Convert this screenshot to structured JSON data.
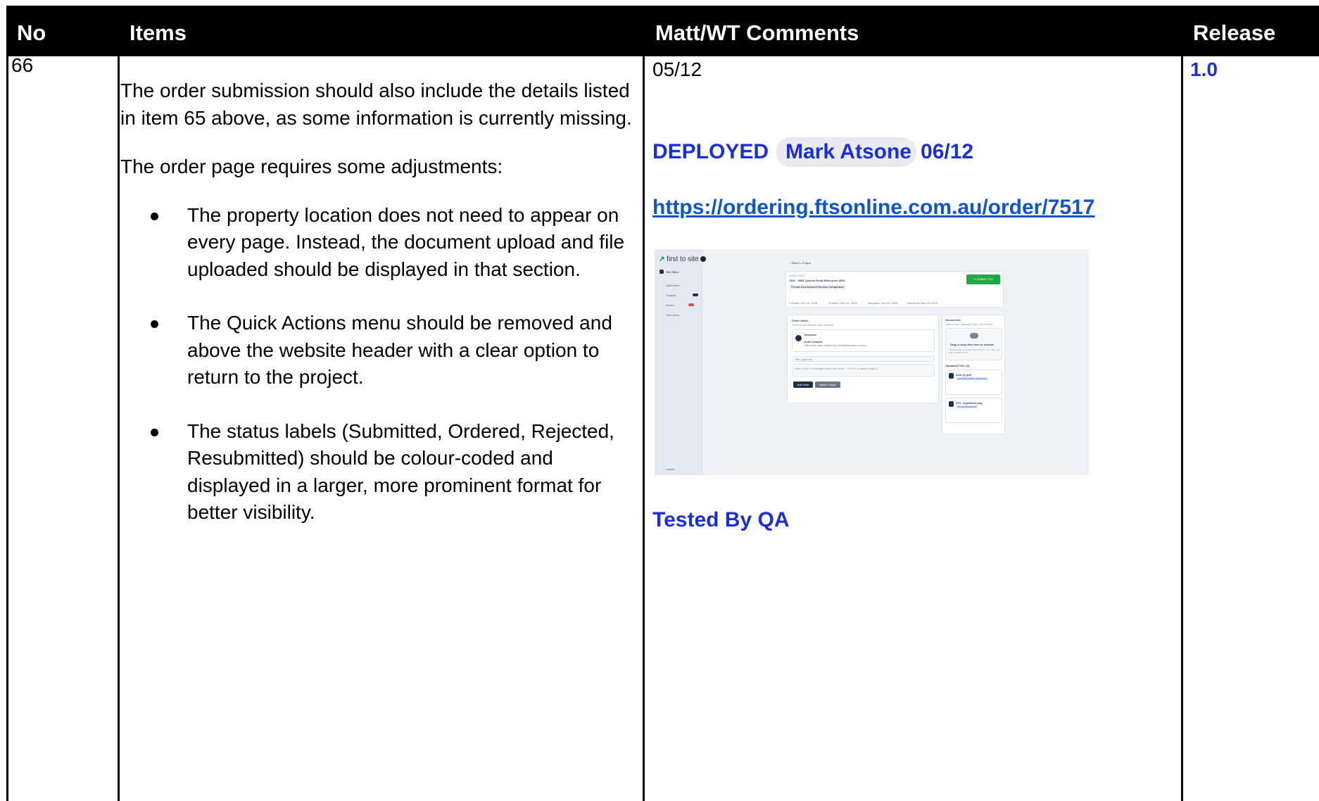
{
  "header": {
    "no": "No",
    "items": "Items",
    "comments": "Matt/WT Comments",
    "release": "Release"
  },
  "row": {
    "no": "66",
    "items": {
      "para1": "The order submission should also include the details listed in item 65 above, as some information is currently missing.",
      "para2": "The order page requires some adjustments:",
      "bullets": [
        "The property location does not need to appear on every page. Instead, the document upload and file uploaded should be displayed in that section.",
        "The Quick Actions menu should be removed and above the website header with a clear option to return to the project.",
        "The status labels (Submitted, Ordered, Rejected, Resubmitted) should be colour-coded and displayed in a larger, more prominent format for better visibility."
      ]
    },
    "comments": {
      "date": "05/12",
      "deployed_label": "DEPLOYED",
      "person_chip": "Mark Atsone",
      "deployed_date": "06/12",
      "link": "https://ordering.ftsonline.com.au/order/7517",
      "tested": "Tested By QA"
    },
    "release": "1.0"
  },
  "screenshot": {
    "logo": "first to site",
    "org": "WA Office",
    "nav": [
      "Dashboard",
      "Projects",
      "Orders",
      "New Order"
    ],
    "logout": "Logout",
    "back": "← Back to Project",
    "order_id": "Order #7517",
    "address": "1522 · 4865 Queens Road Melbourne 3004",
    "pill": "Permit Assessment Review Completion",
    "status": "✔ SUBMITTED",
    "dates": [
      "Created: Dec 04, 2025",
      "Ordered: Dec 04, 2025",
      "Assigned: Dec 04, 2025",
      "Resubmit: Dec 04, 2025"
    ],
    "notes_title": "Order Notes",
    "notes_sub": "Track conversations and updates",
    "note_author": "Unknown",
    "note_body": "Order created",
    "note_detail": "This order was created by name@domain.com.au",
    "new_label": "Title (optional)",
    "new_msg": "Add a note or message about this order... (Ctrl+V to paste images)",
    "add_note": "Add Note",
    "attach": "Attach Image",
    "docs_title": "Documents",
    "docs_sub": "Upload and manage order documents",
    "drop": "Drag & drop files here or browse",
    "supported": "Supported formats: PDF, DOC, DOCX, JPG, PNG, ZIP (Max 100MB per file)",
    "uploaded": "Uploaded Files (2)",
    "files": [
      {
        "name": "view (1).pdf",
        "tag": "ARCHITECTURAL DRAWINGS"
      },
      {
        "name": "FTS_logoWhite.png",
        "tag": "SOLAR DIAGRAMS"
      }
    ],
    "colors": {
      "submitted": "#22a745",
      "navy": "#1f2f4a",
      "badge_red": "#e04848",
      "sidebar": "#e4e8f0"
    }
  }
}
